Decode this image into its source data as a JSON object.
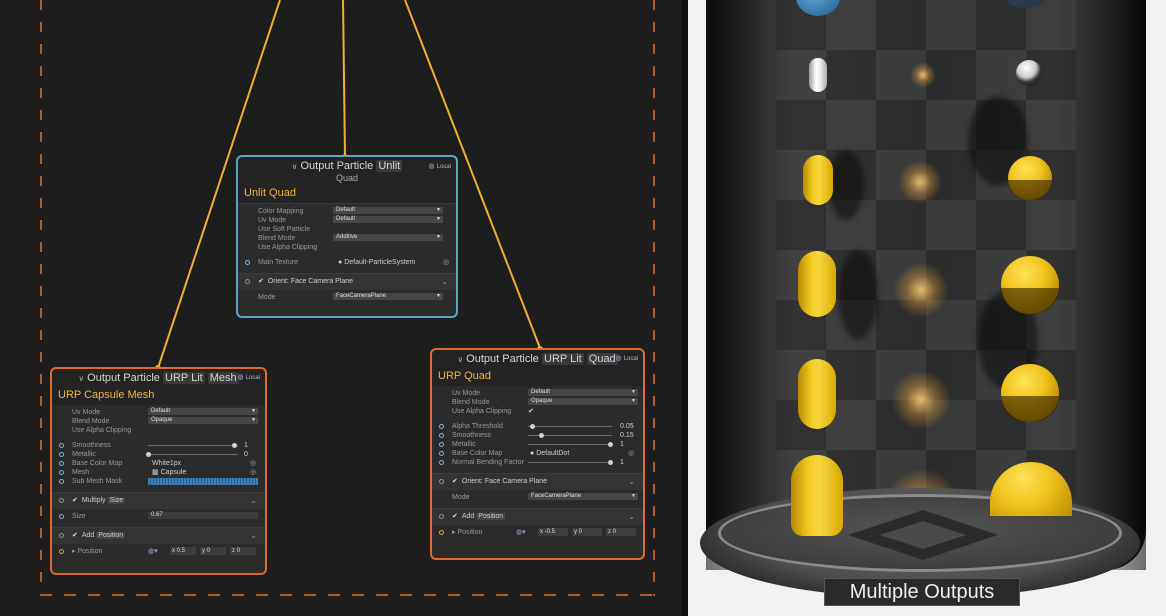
{
  "graph": {
    "node_unlit": {
      "title_prefix": "Output Particle",
      "title_chip": "Unlit",
      "subtitle": "Quad",
      "space": "Local",
      "name": "Unlit Quad",
      "props": [
        {
          "label": "Color Mapping",
          "value": "Default"
        },
        {
          "label": "Uv Mode",
          "value": "Default"
        },
        {
          "label": "Use Soft Particle",
          "value": ""
        },
        {
          "label": "Blend Mode",
          "value": "Additive"
        },
        {
          "label": "Use Alpha Clipping",
          "value": ""
        }
      ],
      "main_texture_label": "Main Texture",
      "main_texture_value": "Default-ParticleSystem",
      "orient_block": "Orient: Face Camera Plane",
      "mode_label": "Mode",
      "mode_value": "FaceCameraPlane"
    },
    "node_mesh": {
      "title_prefix": "Output Particle",
      "title_chip1": "URP Lit",
      "title_chip2": "Mesh",
      "space": "Local",
      "name": "URP Capsule Mesh",
      "props": [
        {
          "label": "Uv Mode",
          "value": "Default"
        },
        {
          "label": "Blend Mode",
          "value": "Opaque"
        },
        {
          "label": "Use Alpha Clipping",
          "value": ""
        }
      ],
      "smoothness_label": "Smoothness",
      "smoothness_value": "1",
      "metallic_label": "Metallic",
      "metallic_value": "0",
      "basecolor_label": "Base Color Map",
      "basecolor_value": "White1px",
      "mesh_label": "Mesh",
      "mesh_value": "Capsule",
      "submesh_label": "Sub Mesh Mask",
      "multiply_block": "Multiply",
      "multiply_suffix": "Size",
      "size_label": "Size",
      "size_value": "0.67",
      "add_block": "Add",
      "add_suffix": "Position",
      "position_label": "Position",
      "pos_x_label": "x",
      "pos_x": "0.5",
      "pos_y_label": "y",
      "pos_y": "0",
      "pos_z_label": "z",
      "pos_z": "0"
    },
    "node_quad": {
      "title_prefix": "Output Particle",
      "title_chip1": "URP Lit",
      "title_chip2": "Quad",
      "space": "Local",
      "name": "URP Quad",
      "props": [
        {
          "label": "Uv Mode",
          "value": "Default"
        },
        {
          "label": "Blend Mode",
          "value": "Opaque"
        },
        {
          "label": "Use Alpha Clipping",
          "value": "✔"
        }
      ],
      "alpha_label": "Alpha Threshold",
      "alpha_value": "0.05",
      "smoothness_label": "Smoothness",
      "smoothness_value": "0.15",
      "metallic_label": "Metallic",
      "metallic_value": "1",
      "basecolor_label": "Base Color Map",
      "basecolor_value": "DefaultDot",
      "normal_label": "Normal Bending Factor",
      "normal_value": "1",
      "orient_block": "Orient: Face Camera Plane",
      "mode_label": "Mode",
      "mode_value": "FaceCameraPlane",
      "add_block": "Add",
      "add_suffix": "Position",
      "position_label": "Position",
      "pos_x_label": "x",
      "pos_x": "-0.5",
      "pos_y_label": "y",
      "pos_y": "0",
      "pos_z_label": "z",
      "pos_z": "0"
    }
  },
  "scene": {
    "caption": "Multiple Outputs"
  },
  "colors": {
    "node_title": "#f2b63c",
    "edge": "#f0b030",
    "group_border": "#b45a22",
    "unlit_border": "#58a8c8",
    "lit_border": "#e06a2a"
  }
}
